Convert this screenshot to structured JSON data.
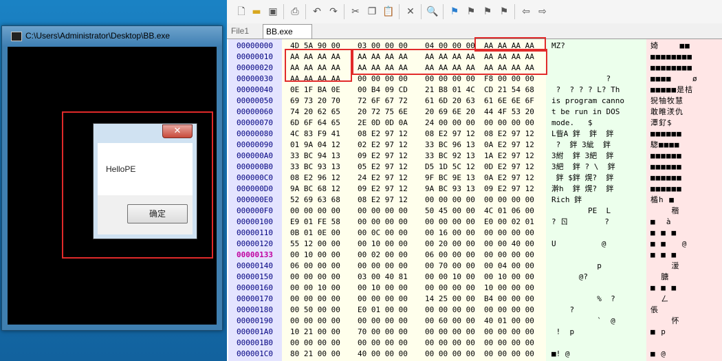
{
  "console": {
    "title": "C:\\Users\\Administrator\\Desktop\\BB.exe"
  },
  "dialog": {
    "close_label": "✕",
    "message": "HelloPE",
    "ok_label": "确定"
  },
  "hex_editor": {
    "tabs": [
      "File1",
      "BB.exe"
    ],
    "toolbar_icons": [
      "new-file-icon",
      "open-folder-icon",
      "save-icon",
      "print-icon",
      "undo-icon",
      "redo-icon",
      "cut-icon",
      "copy-icon",
      "paste-icon",
      "delete-icon",
      "find-icon",
      "bookmark-icon",
      "bookmark-next-icon",
      "bookmark-prev-icon",
      "bookmark-clear-icon",
      "back-icon",
      "forward-icon"
    ],
    "highlight_offset": "00000133",
    "rows": [
      {
        "offset": "00000000",
        "hex": [
          "4D 5A 90 00",
          "03 00 00 00",
          "04 00 00 00",
          "AA AA AA AA"
        ],
        "ascii": "MZ?",
        "wide": "婍    ■■"
      },
      {
        "offset": "00000010",
        "hex": [
          "AA AA AA AA",
          "AA AA AA AA",
          "AA AA AA AA",
          "AA AA AA AA"
        ],
        "ascii": "",
        "wide": "■■■■■■■■"
      },
      {
        "offset": "00000020",
        "hex": [
          "AA AA AA AA",
          "AA AA AA AA",
          "AA AA AA AA",
          "AA AA AA AA"
        ],
        "ascii": "",
        "wide": "■■■■■■■■"
      },
      {
        "offset": "00000030",
        "hex": [
          "AA AA AA AA",
          "00 00 00 00",
          "00 00 00 00",
          "F8 00 00 00"
        ],
        "ascii": "            ?",
        "wide": "■■■■    ø"
      },
      {
        "offset": "00000040",
        "hex": [
          "0E 1F BA 0E",
          "00 B4 09 CD",
          "21 B8 01 4C",
          "CD 21 54 68"
        ],
        "ascii": " ?  ? ? ? L? Th",
        "wide": "■■■■■是桔"
      },
      {
        "offset": "00000050",
        "hex": [
          "69 73 20 70",
          "72 6F 67 72",
          "61 6D 20 63",
          "61 6E 6E 6F"
        ],
        "ascii": "is program canno",
        "wide": "猊牰牧慧"
      },
      {
        "offset": "00000060",
        "hex": [
          "74 20 62 65",
          "20 72 75 6E",
          "20 69 6E 20",
          "44 4F 53 20"
        ],
        "ascii": "t be run in DOS",
        "wide": "敢睢湵仇"
      },
      {
        "offset": "00000070",
        "hex": [
          "6D 6F 64 65",
          "2E 0D 0D 0A",
          "24 00 00 00",
          "00 00 00 00"
        ],
        "ascii": "mode.   $",
        "wide": "潭釕$"
      },
      {
        "offset": "00000080",
        "hex": [
          "4C 83 F9 41",
          "08 E2 97 12",
          "08 E2 97 12",
          "08 E2 97 12"
        ],
        "ascii": "L眥A 鉡  鉡  鉡",
        "wide": "■■■■■■"
      },
      {
        "offset": "00000090",
        "hex": [
          "01 9A 04 12",
          "02 E2 97 12",
          "33 BC 96 13",
          "0A E2 97 12"
        ],
        "ascii": " ?  鉡 3紪  鉡",
        "wide": "騘■■■■"
      },
      {
        "offset": "000000A0",
        "hex": [
          "33 BC 94 13",
          "09 E2 97 12",
          "33 BC 92 13",
          "1A E2 97 12"
        ],
        "ascii": "3紨  鉡 3紦  鉡",
        "wide": "■■■■■■"
      },
      {
        "offset": "000000B0",
        "hex": [
          "33 BC 93 13",
          "05 E2 97 12",
          "D5 1D 5C 12",
          "0D E2 97 12"
        ],
        "ascii": "3紦  鉡 ? \\  鉡",
        "wide": "■■■■■■"
      },
      {
        "offset": "000000C0",
        "hex": [
          "08 E2 96 12",
          "24 E2 97 12",
          "9F BC 9E 13",
          "0A E2 97 12"
        ],
        "ascii": " 鉡 $鉡 熀?  鉡",
        "wide": "■■■■■■"
      },
      {
        "offset": "000000D0",
        "hex": [
          "9A BC 68 12",
          "09 E2 97 12",
          "9A BC 93 13",
          "09 E2 97 12"
        ],
        "ascii": "澣h  鉡 熀?  鉡",
        "wide": "■■■■■■"
      },
      {
        "offset": "000000E0",
        "hex": [
          "52 69 63 68",
          "08 E2 97 12",
          "00 00 00 00",
          "00 00 00 00"
        ],
        "ascii": "Rich 鉡",
        "wide": "楯h ■"
      },
      {
        "offset": "000000F0",
        "hex": [
          "00 00 00 00",
          "00 00 00 00",
          "50 45 00 00",
          "4C 01 06 00"
        ],
        "ascii": "        PE  L",
        "wide": "    稭"
      },
      {
        "offset": "00000100",
        "hex": [
          "E9 01 FE 58",
          "00 00 00 00",
          "00 00 00 00",
          "E0 00 02 01"
        ],
        "ascii": "? ㄖ        ?",
        "wide": "■  à"
      },
      {
        "offset": "00000110",
        "hex": [
          "0B 01 0E 00",
          "00 0C 00 00",
          "00 16 00 00",
          "00 00 00 00"
        ],
        "ascii": "",
        "wide": "■ ■ ■"
      },
      {
        "offset": "00000120",
        "hex": [
          "55 12 00 00",
          "00 10 00 00",
          "00 20 00 00",
          "00 00 40 00"
        ],
        "ascii": "U          @",
        "wide": "■ ■   @"
      },
      {
        "offset": "00000133",
        "hex": [
          "00 10 00 00",
          "00 02 00 00",
          "06 00 00 00",
          "00 00 00 00"
        ],
        "ascii": "",
        "wide": "■ ■ ■"
      },
      {
        "offset": "00000140",
        "hex": [
          "06 00 00 00",
          "00 00 00 00",
          "00 70 00 00",
          "00 04 00 00"
        ],
        "ascii": "          p",
        "wide": "    湲"
      },
      {
        "offset": "00000150",
        "hex": [
          "00 00 00 00",
          "03 00 40 81",
          "00 00 10 00",
          "00 10 00 00"
        ],
        "ascii": "      @?",
        "wide": "  膅"
      },
      {
        "offset": "00000160",
        "hex": [
          "00 00 10 00",
          "00 10 00 00",
          "00 00 00 00",
          "10 00 00 00"
        ],
        "ascii": "",
        "wide": "■ ■ ■"
      },
      {
        "offset": "00000170",
        "hex": [
          "00 00 00 00",
          "00 00 00 00",
          "14 25 00 00",
          "B4 00 00 00"
        ],
        "ascii": "          %  ?",
        "wide": "  ㄥ"
      },
      {
        "offset": "00000180",
        "hex": [
          "00 50 00 00",
          "E0 01 00 00",
          "00 00 00 00",
          "00 00 00 00"
        ],
        "ascii": "    ?",
        "wide": "倀"
      },
      {
        "offset": "00000190",
        "hex": [
          "00 00 00 00",
          "00 00 00 00",
          "00 60 00 00",
          "40 01 00 00"
        ],
        "ascii": "          `  @",
        "wide": "    怀"
      },
      {
        "offset": "000001A0",
        "hex": [
          "10 21 00 00",
          "70 00 00 00",
          "00 00 00 00",
          "00 00 00 00"
        ],
        "ascii": " !  p",
        "wide": "■ p"
      },
      {
        "offset": "000001B0",
        "hex": [
          "00 00 00 00",
          "00 00 00 00",
          "00 00 00 00",
          "00 00 00 00"
        ],
        "ascii": "",
        "wide": ""
      },
      {
        "offset": "000001C0",
        "hex": [
          "80 21 00 00",
          "40 00 00 00",
          "00 00 00 00",
          "00 00 00 00"
        ],
        "ascii": "■! @",
        "wide": "■ @"
      }
    ]
  }
}
